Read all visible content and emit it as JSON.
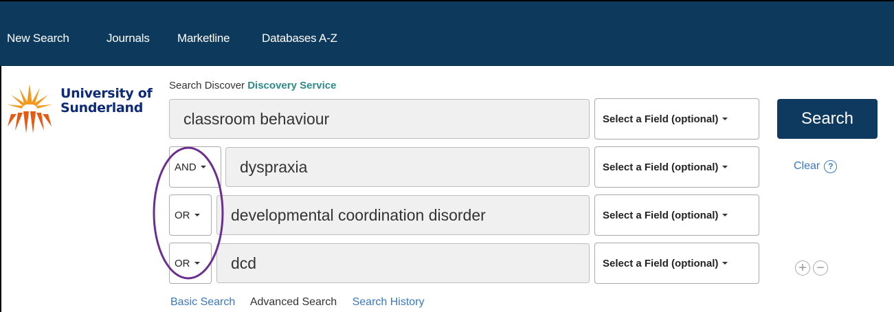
{
  "nav": {
    "items": [
      "New Search",
      "Journals",
      "Marketline",
      "Databases A-Z"
    ]
  },
  "logo": {
    "line1": "University of",
    "line2": "Sunderland"
  },
  "search_header": {
    "prefix": "Search Discover",
    "service": "Discovery Service"
  },
  "rows": [
    {
      "bool": "",
      "query": "classroom behaviour",
      "field": "Select a Field (optional)"
    },
    {
      "bool": "AND",
      "query": "dyspraxia",
      "field": "Select a Field (optional)"
    },
    {
      "bool": "OR",
      "query": "developmental coordination disorder",
      "field": "Select a Field (optional)"
    },
    {
      "bool": "OR",
      "query": "dcd",
      "field": "Select a Field (optional)"
    }
  ],
  "search_button": "Search",
  "clear": {
    "label": "Clear",
    "help": "?"
  },
  "row_controls": {
    "add": "+",
    "remove": "−"
  },
  "links": {
    "basic": "Basic Search",
    "advanced": "Advanced Search",
    "history": "Search History"
  },
  "colors": {
    "nav_bg": "#0d3a5c",
    "search_btn": "#0f3a5f",
    "link": "#3a78c2",
    "annotation": "#6b2d8e"
  }
}
